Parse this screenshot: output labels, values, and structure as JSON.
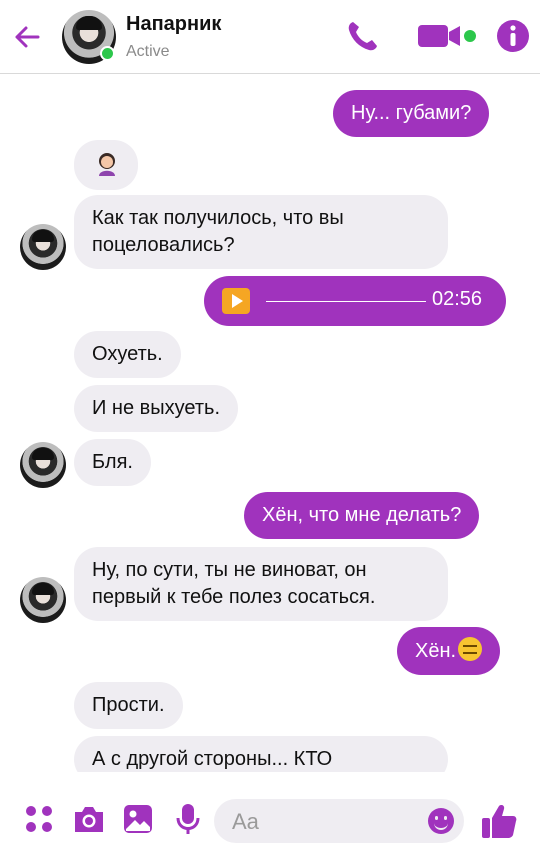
{
  "header": {
    "contact_name": "Напарник",
    "contact_status": "Active",
    "back_icon": "arrow-left-icon",
    "actions": [
      "phone-icon",
      "video-camera-icon",
      "info-icon"
    ]
  },
  "messages": [
    {
      "from": "me",
      "text": "Ну... губами?"
    },
    {
      "from": "them",
      "emoji": "woman-facepalming"
    },
    {
      "from": "them",
      "text": "Как так получилось, что вы поцеловались?"
    },
    {
      "from": "me",
      "type": "voice",
      "duration": "02:56"
    },
    {
      "from": "them",
      "text": "Охуеть."
    },
    {
      "from": "them",
      "text": "И не выхуеть."
    },
    {
      "from": "them",
      "text": "Бля."
    },
    {
      "from": "me",
      "text": "Хён, что мне делать?"
    },
    {
      "from": "them",
      "text": "Ну, по сути, ты не виноват, он первый к тебе полез сосаться."
    },
    {
      "from": "me",
      "text": "Хён.",
      "emoji": "expressionless-face"
    },
    {
      "from": "them",
      "text": "Прости."
    },
    {
      "from": "them",
      "text": "А с другой стороны... КТО"
    }
  ],
  "composer": {
    "placeholder": "Aa",
    "icons": [
      "apps-icon",
      "camera-icon",
      "gallery-icon",
      "microphone-icon",
      "emoji-icon",
      "thumbs-up-icon"
    ]
  },
  "colors": {
    "accent": "#a033bd",
    "incoming_bubble": "#efedf2",
    "online": "#2cc74b"
  }
}
